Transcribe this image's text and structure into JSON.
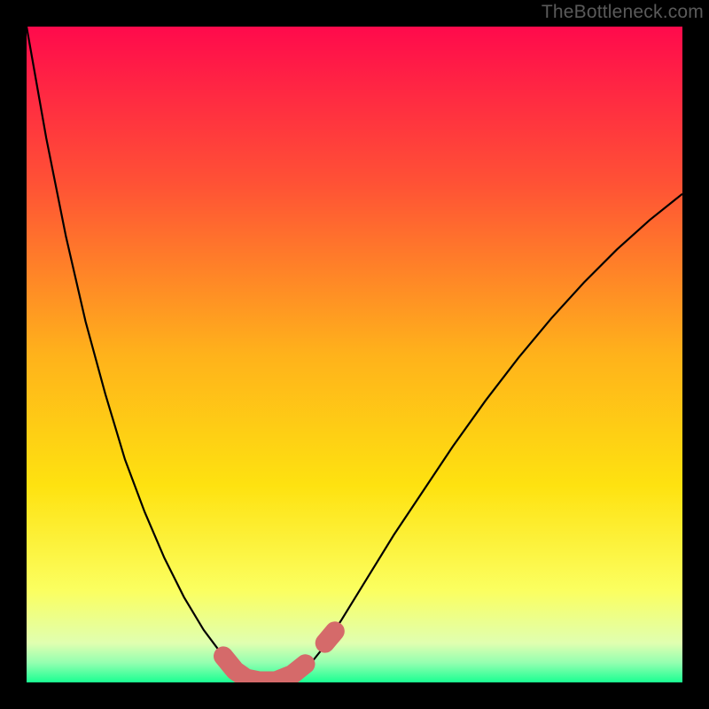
{
  "attribution": "TheBottleneck.com",
  "chart_data": {
    "type": "line",
    "title": "",
    "xlabel": "",
    "ylabel": "",
    "xlim": [
      0,
      1
    ],
    "ylim": [
      0,
      1
    ],
    "background_gradient_rows": [
      {
        "y_from": 0.0,
        "y_to": 0.24,
        "top": "#ff0a4c",
        "bottom": "#ff5235"
      },
      {
        "y_from": 0.24,
        "y_to": 0.5,
        "top": "#ff5235",
        "bottom": "#ffb21b"
      },
      {
        "y_from": 0.5,
        "y_to": 0.7,
        "top": "#ffb21b",
        "bottom": "#fee210"
      },
      {
        "y_from": 0.7,
        "y_to": 0.86,
        "top": "#fee210",
        "bottom": "#fbff60"
      },
      {
        "y_from": 0.86,
        "y_to": 0.94,
        "top": "#fbff60",
        "bottom": "#e0ffb0"
      },
      {
        "y_from": 0.94,
        "y_to": 0.97,
        "top": "#e0ffb0",
        "bottom": "#94ffb0"
      },
      {
        "y_from": 0.97,
        "y_to": 1.0,
        "top": "#94ffb0",
        "bottom": "#1aff92"
      }
    ],
    "series": [
      {
        "name": "bottleneck-curve",
        "stroke": "#000000",
        "stroke_width": 2.2,
        "x": [
          0.0,
          0.03,
          0.06,
          0.09,
          0.12,
          0.15,
          0.18,
          0.21,
          0.24,
          0.27,
          0.3,
          0.318,
          0.33,
          0.35,
          0.37,
          0.39,
          0.41,
          0.43,
          0.45,
          0.48,
          0.52,
          0.56,
          0.6,
          0.65,
          0.7,
          0.75,
          0.8,
          0.85,
          0.9,
          0.95,
          1.0
        ],
        "y": [
          0.0,
          0.17,
          0.32,
          0.45,
          0.56,
          0.66,
          0.74,
          0.81,
          0.87,
          0.92,
          0.96,
          0.98,
          0.99,
          0.998,
          1.0,
          0.998,
          0.99,
          0.975,
          0.95,
          0.905,
          0.84,
          0.775,
          0.715,
          0.64,
          0.57,
          0.505,
          0.445,
          0.39,
          0.34,
          0.295,
          0.255
        ]
      },
      {
        "name": "bottom-marker",
        "stroke": "#d56a6a",
        "stroke_width": 22,
        "linecap": "round",
        "x": [
          0.3,
          0.318,
          0.335,
          0.355,
          0.38,
          0.405,
          0.425
        ],
        "y": [
          0.96,
          0.982,
          0.994,
          0.998,
          0.998,
          0.988,
          0.972
        ]
      },
      {
        "name": "right-dot",
        "stroke": "#d56a6a",
        "stroke_width": 22,
        "linecap": "round",
        "x": [
          0.455,
          0.47
        ],
        "y": [
          0.94,
          0.922
        ]
      }
    ]
  }
}
